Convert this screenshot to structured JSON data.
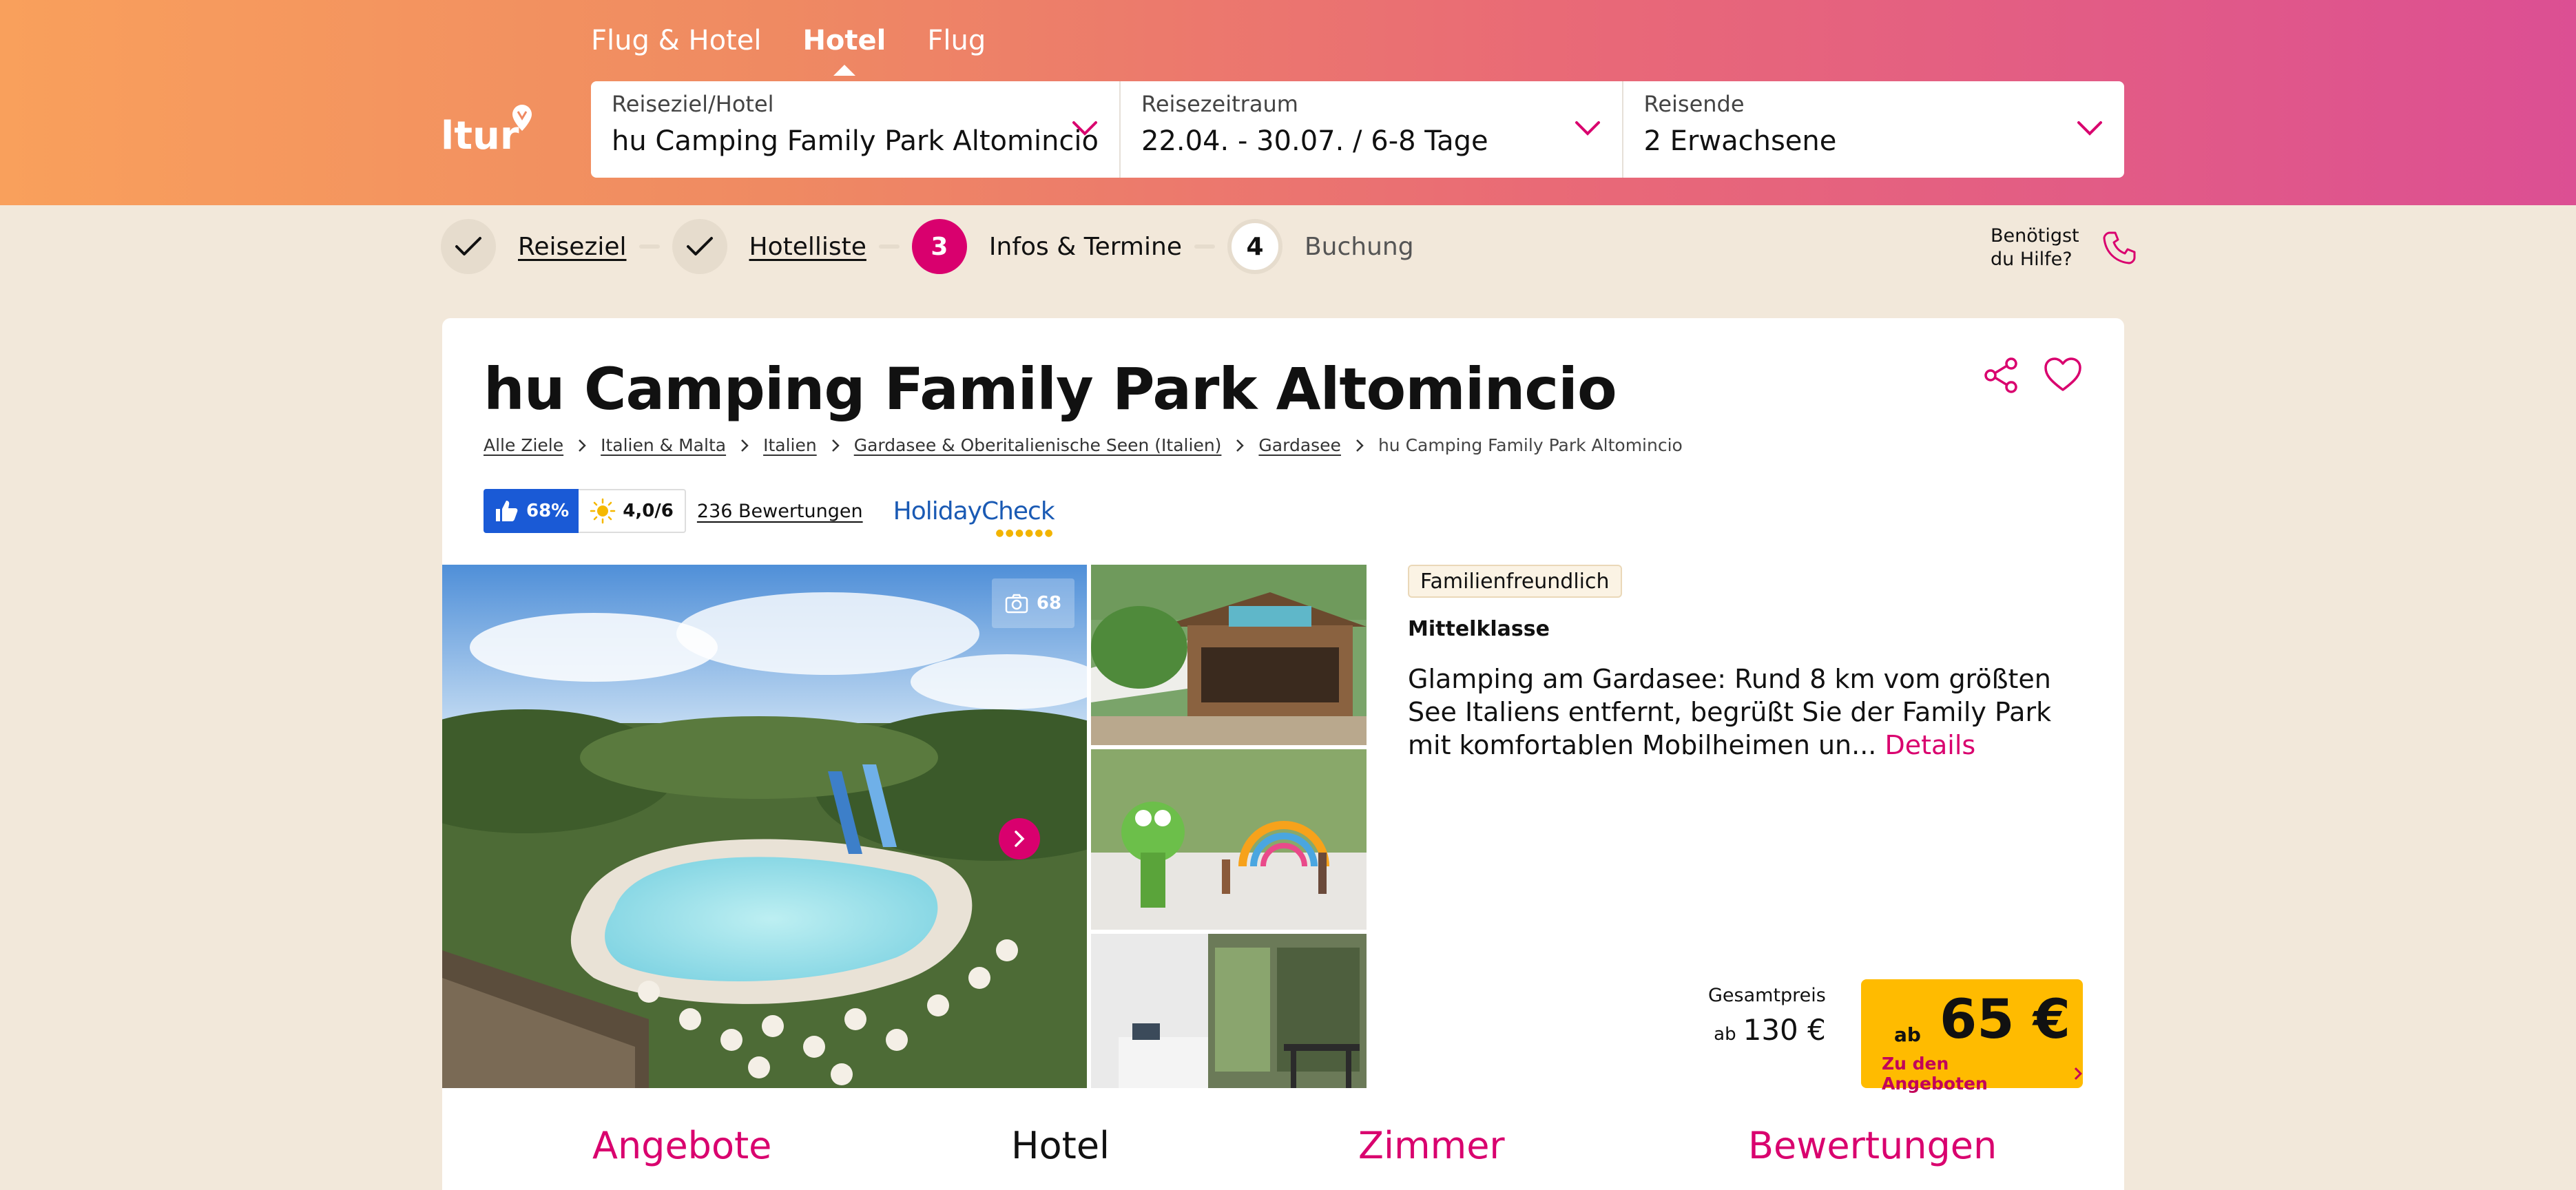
{
  "header": {
    "logo_text": "ltur",
    "tabs": [
      {
        "label": "Flug & Hotel",
        "active": false
      },
      {
        "label": "Hotel",
        "active": true
      },
      {
        "label": "Flug",
        "active": false
      }
    ],
    "search": {
      "destination": {
        "label": "Reiseziel/Hotel",
        "value": "hu Camping Family Park Altomincio"
      },
      "period": {
        "label": "Reisezeitraum",
        "value": "22.04. - 30.07. / 6-8 Tage"
      },
      "travelers": {
        "label": "Reisende",
        "value": "2 Erwachsene"
      }
    }
  },
  "stepper": {
    "steps": [
      {
        "label": "Reiseziel",
        "state": "done"
      },
      {
        "label": "Hotelliste",
        "state": "done"
      },
      {
        "number": "3",
        "label": "Infos & Termine",
        "state": "current"
      },
      {
        "number": "4",
        "label": "Buchung",
        "state": "upcoming"
      }
    ],
    "help_line1": "Benötigst",
    "help_line2": "du Hilfe?"
  },
  "hotel": {
    "title": "hu Camping Family Park Altomincio",
    "breadcrumb": [
      "Alle Ziele",
      "Italien & Malta",
      "Italien",
      "Gardasee & Oberitalienische Seen (Italien)",
      "Gardasee",
      "hu Camping Family Park Altomincio"
    ],
    "rating": {
      "recommendation": "68%",
      "score": "4,0/6",
      "reviews": "236 Bewertungen",
      "provider": "HolidayCheck"
    },
    "photo_count": "68",
    "badge": "Familienfreundlich",
    "category": "Mittelklasse",
    "description": "Glamping am Gardasee: Rund 8 km vom größten See Italiens entfernt, begrüßt Sie der Family Park mit komfortablen Mobilheimen un...",
    "details_link": "Details",
    "price": {
      "total_label": "Gesamtpreis",
      "total_prefix": "ab",
      "total_value": "130 €",
      "from_prefix": "ab",
      "amount": "65 €",
      "cta_label": "Zu den Angeboten"
    },
    "sections": [
      "Angebote",
      "Hotel",
      "Zimmer",
      "Bewertungen"
    ]
  },
  "colors": {
    "accent": "#d9006e",
    "cta": "#ffbb00",
    "holidaycheck_blue": "#1a5ad6"
  }
}
